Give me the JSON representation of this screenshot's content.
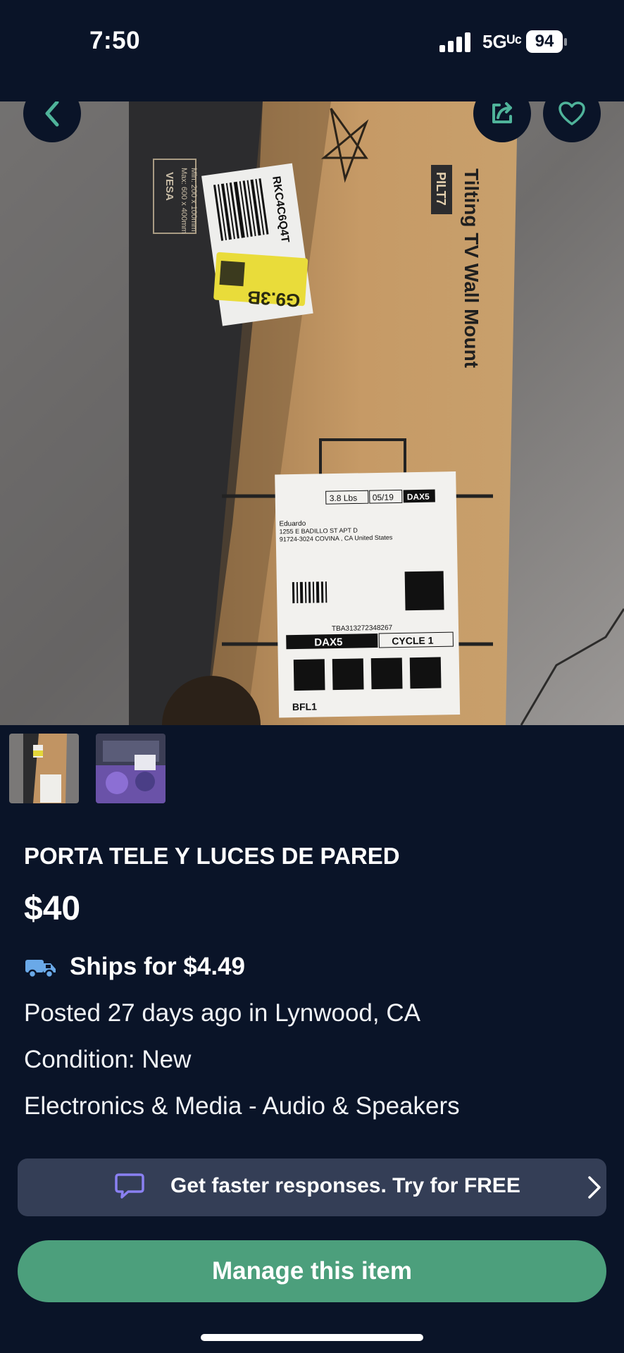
{
  "status_bar": {
    "time": "7:50",
    "network": "5Gᵁᶜ",
    "battery": "94",
    "icons": [
      "signal-bars-icon",
      "battery-icon"
    ]
  },
  "listing": {
    "title": "PORTA TELE Y LUCES DE PARED",
    "price": "$40",
    "shipping": "Ships for $4.49",
    "posted": "Posted 27 days ago in Lynwood, CA",
    "condition": "Condition: New",
    "category": "Electronics & Media - Audio & Speakers",
    "photo_count": 2
  },
  "hero_photo": {
    "box_text": "Tilting TV Wall Mount",
    "model_label": "PILT7",
    "vesa_label": "VESA",
    "vesa_spec_1": "Max: 600 x 400mm",
    "vesa_spec_2": "Min: 200 x 100mm",
    "barcode_code": "RKC4C6Q4T",
    "sticker_code": "G9.3B",
    "ship_label": {
      "weight": "3.8 Lbs",
      "date": "05/19",
      "station": "DAX5",
      "name": "Eduardo",
      "address_1": "1255 E BADILLO ST APT D",
      "address_2": "91724-3024 COVINA , CA United States",
      "tracking": "TBA313272348267",
      "route": "DAX5",
      "cycle": "CYCLE 1",
      "bin": "BFL1"
    }
  },
  "promo": {
    "text": "Get faster responses.  Try for FREE"
  },
  "actions": {
    "manage_label": "Manage this item"
  },
  "colors": {
    "background": "#0a1428",
    "promo_bg": "#343e56",
    "accent_green": "#4c9f7c",
    "promo_icon": "#8a80f2",
    "truck_icon": "#6aa9e8"
  }
}
